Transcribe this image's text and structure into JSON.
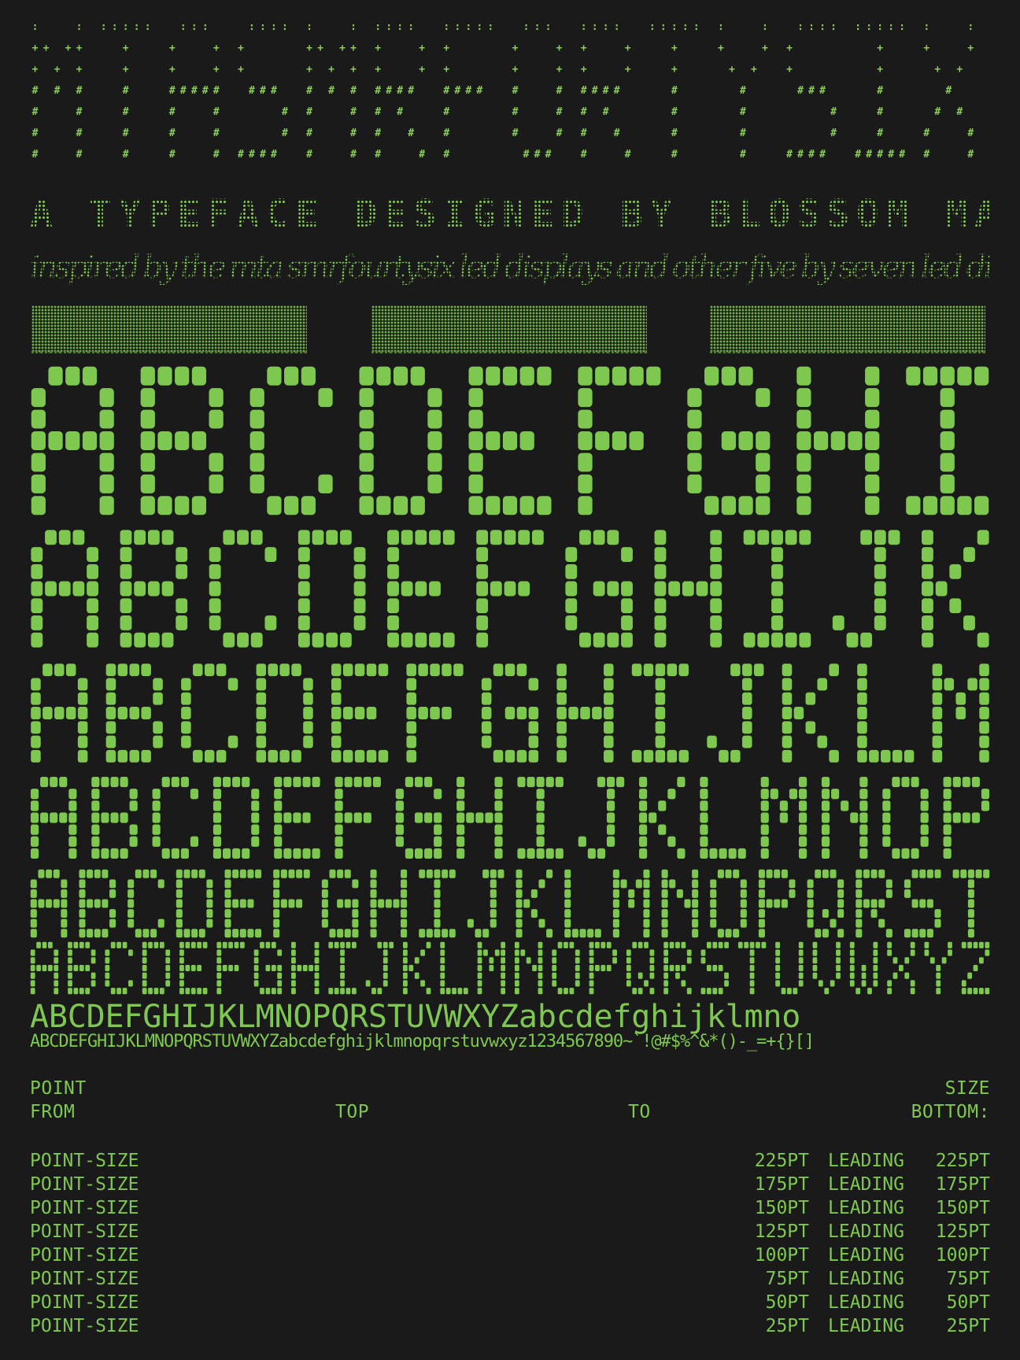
{
  "title_letters": [
    "M",
    "T",
    "A",
    "S",
    "M",
    "R",
    "F",
    "O",
    "R",
    "T",
    "Y",
    "S",
    "I",
    "X"
  ],
  "credit": "A TYPEFACE DESIGNED BY BLOSSOM MARQUEZ",
  "inspired": "inspired by the mta smrfourtysix led displays and other five by seven led displays",
  "specimen_rows": [
    {
      "text": "ABCDEFGHI"
    },
    {
      "text": "ABCDEFGHIJK"
    },
    {
      "text": "ABCDEFGHIJKLM"
    },
    {
      "text": "ABCDEFGHIJKLMNOP"
    },
    {
      "text": "ABCDEFGHIJKLMNOPQRST"
    },
    {
      "text": "ABCDEFGHIJKLMNOPQRSTUVWXYZ"
    }
  ],
  "text_rows": [
    {
      "text": "ABCDEFGHIJKLMNOPQRSTUVWXYZabcdefghijklmno"
    },
    {
      "text": "ABCDEFGHIJKLMNOPQRSTUVWXYZabcdefghijklmnopqrstuvwxyz1234567890~`!@#$%^&*()-_=+{}[]"
    }
  ],
  "header": {
    "point": "POINT",
    "size": "SIZE",
    "from": "FROM",
    "top": "TOP",
    "to": "TO",
    "bottom": "BOTTOM:"
  },
  "size_rows": [
    {
      "label": "POINT-SIZE",
      "pt": "225PT",
      "leading": "LEADING",
      "lpt": "225PT"
    },
    {
      "label": "POINT-SIZE",
      "pt": "175PT",
      "leading": "LEADING",
      "lpt": "175PT"
    },
    {
      "label": "POINT-SIZE",
      "pt": "150PT",
      "leading": "LEADING",
      "lpt": "150PT"
    },
    {
      "label": "POINT-SIZE",
      "pt": "125PT",
      "leading": "LEADING",
      "lpt": "125PT"
    },
    {
      "label": "POINT-SIZE",
      "pt": "100PT",
      "leading": "LEADING",
      "lpt": "100PT"
    },
    {
      "label": "POINT-SIZE",
      "pt": "75PT",
      "leading": "LEADING",
      "lpt": "75PT"
    },
    {
      "label": "POINT-SIZE",
      "pt": "50PT",
      "leading": "LEADING",
      "lpt": "50PT"
    },
    {
      "label": "POINT-SIZE",
      "pt": "25PT",
      "leading": "LEADING",
      "lpt": "25PT"
    }
  ],
  "colors": {
    "background": "#1a1a1a",
    "led": "#7ec850"
  }
}
